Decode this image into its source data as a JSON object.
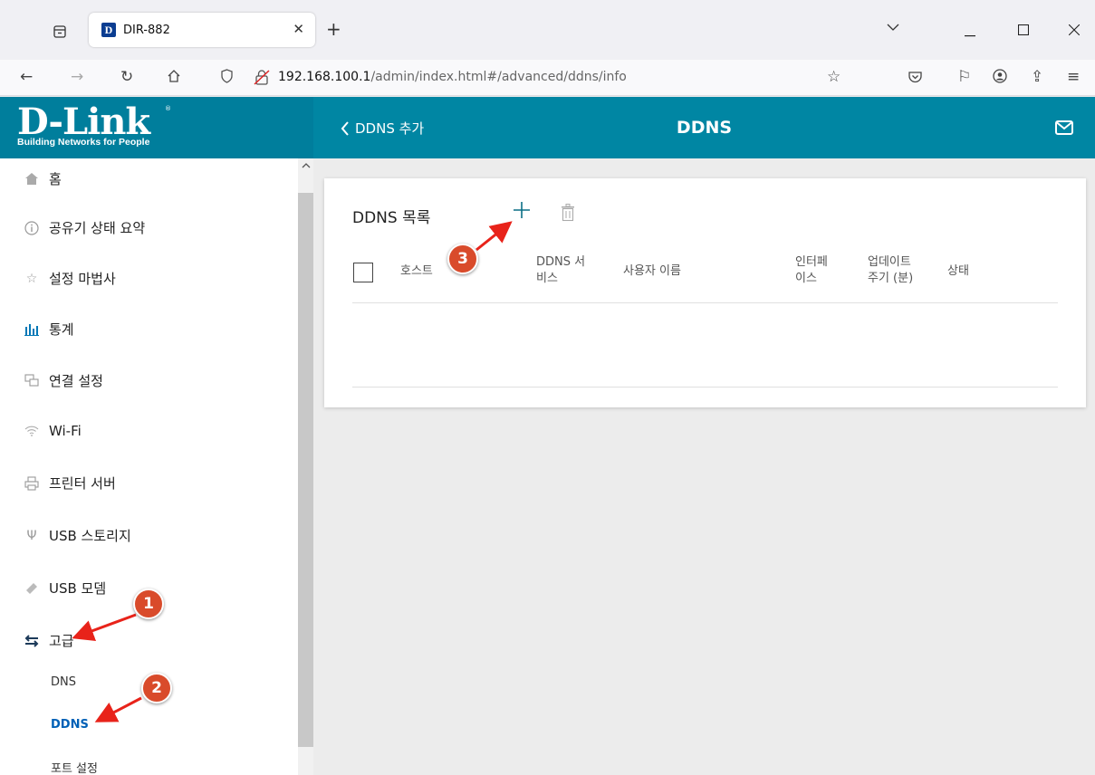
{
  "browser": {
    "tab_title": "DIR-882",
    "tab_favicon": "D",
    "url_host": "192.168.100.1",
    "url_path": "/admin/index.html#/advanced/ddns/info"
  },
  "app": {
    "logo_text": "D-Link",
    "logo_registered": "®",
    "logo_tagline": "Building Networks for People",
    "back_label": "DDNS 추가",
    "page_title": "DDNS"
  },
  "sidebar": {
    "items": [
      {
        "label": "홈",
        "icon": "home-icon"
      },
      {
        "label": "공유기 상태 요약",
        "icon": "info-icon"
      },
      {
        "label": "설정 마법사",
        "icon": "star-icon"
      },
      {
        "label": "통계",
        "icon": "bar-chart-icon"
      },
      {
        "label": "연결 설정",
        "icon": "network-icon"
      },
      {
        "label": "Wi-Fi",
        "icon": "wifi-icon"
      },
      {
        "label": "프린터 서버",
        "icon": "printer-icon"
      },
      {
        "label": "USB 스토리지",
        "icon": "usb-icon"
      },
      {
        "label": "USB 모뎀",
        "icon": "modem-icon"
      },
      {
        "label": "고급",
        "icon": "swap-arrows-icon"
      }
    ],
    "subitems": [
      {
        "label": "DNS"
      },
      {
        "label": "DDNS"
      },
      {
        "label": "포트 설정"
      }
    ]
  },
  "main": {
    "card_title": "DDNS 목록",
    "columns": {
      "host": "호스트",
      "service_1": "DDNS 서",
      "service_2": "비스",
      "username": "사용자 이름",
      "interface_1": "인터페",
      "interface_2": "이스",
      "update_1": "업데이트",
      "update_2": "주기 (분)",
      "status": "상태"
    }
  },
  "annotations": {
    "badge_1": "1",
    "badge_2": "2",
    "badge_3": "3",
    "color": "#d94b2b",
    "arrow_color": "#e8231a"
  },
  "colors": {
    "header_bg": "#0086a3",
    "logo_bg": "#007e9c",
    "active_link": "#0060b6"
  }
}
